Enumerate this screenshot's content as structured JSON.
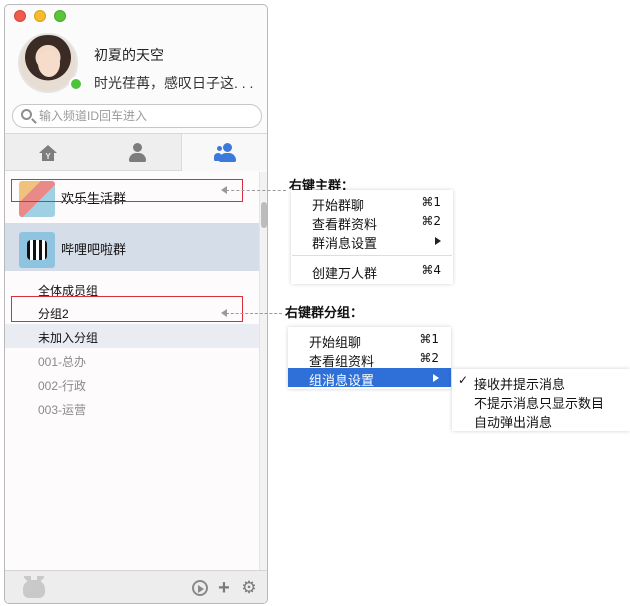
{
  "profile": {
    "nickname": "初夏的天空",
    "signature": "时光荏苒，感叹日子这. . ."
  },
  "search": {
    "placeholder": "输入频道ID回车进入"
  },
  "tabs": [
    {
      "name": "yy-channel",
      "icon": "house-y-icon"
    },
    {
      "name": "contacts",
      "icon": "person-icon"
    },
    {
      "name": "groups",
      "icon": "group-icon",
      "selected": true
    }
  ],
  "groups": [
    {
      "label": "欢乐生活群"
    },
    {
      "label": "哔哩吧啦群",
      "selected": true
    }
  ],
  "subgroups": [
    {
      "label": "全体成员组"
    },
    {
      "label": "分组2"
    },
    {
      "label": "未加入分组"
    },
    {
      "label": "001-总办"
    },
    {
      "label": "002-行政"
    },
    {
      "label": "003-运营"
    }
  ],
  "annotations": {
    "main_group_caption": "右键主群：",
    "subgroup_caption": "右键群分组："
  },
  "main_group_menu": [
    {
      "label": "开始群聊",
      "shortcut": "⌘1"
    },
    {
      "label": "查看群资料",
      "shortcut": "⌘2"
    },
    {
      "label": "群消息设置",
      "submenu": true
    },
    {
      "label": "创建万人群",
      "shortcut": "⌘4"
    }
  ],
  "subgroup_menu": [
    {
      "label": "开始组聊",
      "shortcut": "⌘1"
    },
    {
      "label": "查看组资料",
      "shortcut": "⌘2"
    },
    {
      "label": "组消息设置",
      "submenu": true,
      "highlighted": true
    }
  ],
  "message_settings_submenu": [
    {
      "label": "接收并提示消息",
      "checked": true
    },
    {
      "label": "不提示消息只显示数目"
    },
    {
      "label": "自动弹出消息"
    }
  ],
  "colors": {
    "highlight": "#2e6fd8",
    "annotation_box": "#d6303a",
    "online": "#4cc43a",
    "selected_row": "#d5dde8"
  }
}
